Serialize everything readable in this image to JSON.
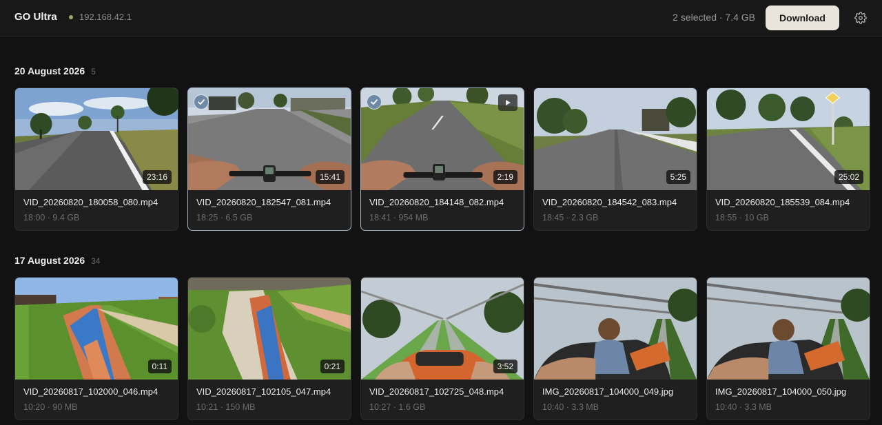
{
  "header": {
    "app_title": "GO Ultra",
    "connection_color": "#9aa86b",
    "ip_address": "192.168.42.1",
    "selection_summary": "2 selected · 7.4 GB",
    "download_label": "Download",
    "download_bg": "#e9e5dc",
    "settings_icon": "gear-icon"
  },
  "sections": [
    {
      "title": "20 August 2026",
      "count": "5",
      "items": [
        {
          "name": "VID_20260820_180058_080.mp4",
          "meta": "18:00 · 9.4 GB",
          "duration": "23:16",
          "selected": false,
          "playing": false
        },
        {
          "name": "VID_20260820_182547_081.mp4",
          "meta": "18:25 · 6.5 GB",
          "duration": "15:41",
          "selected": true,
          "playing": false
        },
        {
          "name": "VID_20260820_184148_082.mp4",
          "meta": "18:41 · 954 MB",
          "duration": "2:19",
          "selected": true,
          "playing": true
        },
        {
          "name": "VID_20260820_184542_083.mp4",
          "meta": "18:45 · 2.3 GB",
          "duration": "5:25",
          "selected": false,
          "playing": false
        },
        {
          "name": "VID_20260820_185539_084.mp4",
          "meta": "18:55 · 10 GB",
          "duration": "25:02",
          "selected": false,
          "playing": false
        }
      ]
    },
    {
      "title": "17 August 2026",
      "count": "34",
      "items": [
        {
          "name": "VID_20260817_102000_046.mp4",
          "meta": "10:20 · 90 MB",
          "duration": "0:11",
          "selected": false,
          "playing": false
        },
        {
          "name": "VID_20260817_102105_047.mp4",
          "meta": "10:21 · 150 MB",
          "duration": "0:21",
          "selected": false,
          "playing": false
        },
        {
          "name": "VID_20260817_102725_048.mp4",
          "meta": "10:27 · 1.6 GB",
          "duration": "3:52",
          "selected": false,
          "playing": false
        },
        {
          "name": "IMG_20260817_104000_049.jpg",
          "meta": "10:40 · 3.3 MB",
          "duration": "",
          "selected": false,
          "playing": false
        },
        {
          "name": "IMG_20260817_104000_050.jpg",
          "meta": "10:40 · 3.3 MB",
          "duration": "",
          "selected": false,
          "playing": false
        }
      ]
    }
  ]
}
